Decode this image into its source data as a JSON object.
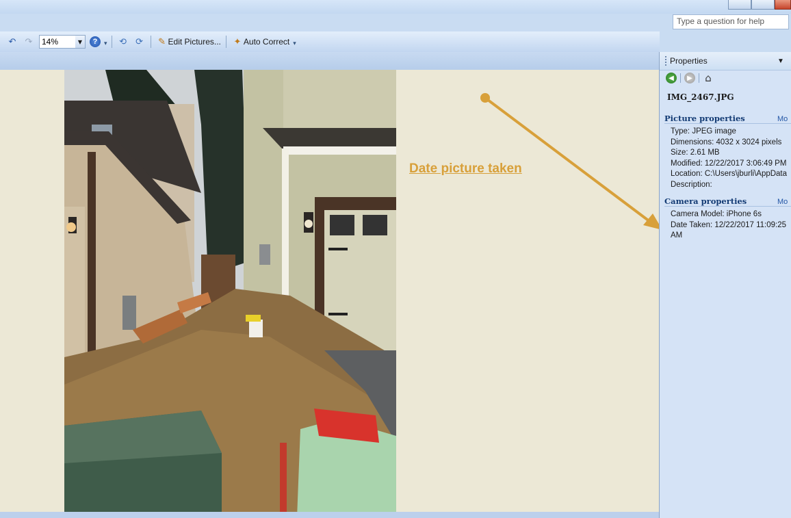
{
  "help": {
    "placeholder": "Type a question for help"
  },
  "toolbar": {
    "zoom_value": "14%",
    "edit_pictures_label": "Edit Pictures...",
    "auto_correct_label": "Auto Correct"
  },
  "annotation": {
    "text": "Date picture taken",
    "color": "#d8a03a"
  },
  "taskpane": {
    "title": "Properties",
    "file_name": "IMG_2467.JPG",
    "picture_section": {
      "title": "Picture properties",
      "more": "Mo",
      "type": "Type: JPEG image",
      "dimensions": "Dimensions: 4032 x 3024 pixels",
      "size": "Size: 2.61 MB",
      "modified": "Modified: 12/22/2017 3:06:49 PM",
      "location": "Location:  C:\\Users\\jburli\\AppData",
      "description": "Description:"
    },
    "camera_section": {
      "title": "Camera properties",
      "more": "Mo",
      "model": "Camera Model: iPhone 6s",
      "date_taken": "Date Taken: 12/22/2017 11:09:25 AM"
    }
  }
}
